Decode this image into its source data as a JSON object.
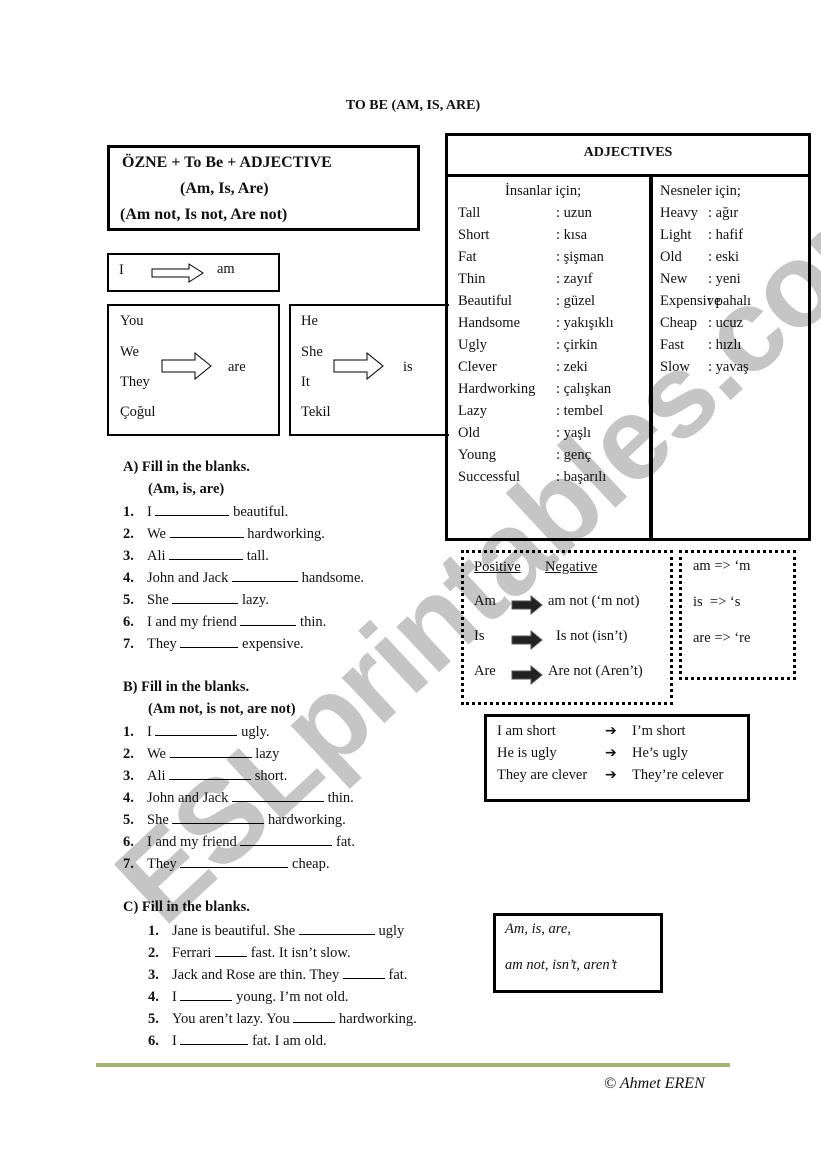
{
  "title": "TO BE (AM, IS, ARE)",
  "formula": {
    "line1": "ÖZNE   +  To Be  +  ADJECTIVE",
    "line2": "(Am, Is, Are)",
    "line3": "(Am not, Is not, Are not)"
  },
  "pronouns": {
    "first": {
      "subjects": [
        "I"
      ],
      "verb": "am"
    },
    "plural": {
      "subjects": [
        "You",
        "We",
        "They",
        "Çoğul"
      ],
      "verb": "are"
    },
    "singular": {
      "subjects": [
        "He",
        "She",
        "It",
        "Tekil"
      ],
      "verb": "is"
    }
  },
  "adjectives": {
    "heading": "ADJECTIVES",
    "people": {
      "heading": "İnsanlar için;",
      "items": [
        {
          "en": "Tall",
          "tr": ": uzun"
        },
        {
          "en": "Short",
          "tr": ": kısa"
        },
        {
          "en": "Fat",
          "tr": ": şişman"
        },
        {
          "en": "Thin",
          "tr": ": zayıf"
        },
        {
          "en": "Beautiful",
          "tr": ": güzel"
        },
        {
          "en": "Handsome",
          "tr": ": yakışıklı"
        },
        {
          "en": "Ugly",
          "tr": ": çirkin"
        },
        {
          "en": "Clever",
          "tr": ": zeki"
        },
        {
          "en": "Hardworking",
          "tr": ": çalışkan"
        },
        {
          "en": "Lazy",
          "tr": ": tembel"
        },
        {
          "en": "Old",
          "tr": ": yaşlı"
        },
        {
          "en": "Young",
          "tr": ": genç"
        },
        {
          "en": "Successful",
          "tr": ": başarılı"
        }
      ]
    },
    "objects": {
      "heading": "Nesneler için;",
      "items": [
        {
          "en": "Heavy",
          "tr": ": ağır"
        },
        {
          "en": "Light",
          "tr": ": hafif"
        },
        {
          "en": "Old",
          "tr": ": eski"
        },
        {
          "en": "New",
          "tr": ": yeni"
        },
        {
          "en": "Expensive",
          "tr": ": pahalı"
        },
        {
          "en": "Cheap",
          "tr": ": ucuz"
        },
        {
          "en": "Fast",
          "tr": ": hızlı"
        },
        {
          "en": "Slow",
          "tr": ": yavaş"
        }
      ]
    }
  },
  "negatives": {
    "positive_label": "Positive",
    "negative_label": "Negative",
    "rows": [
      {
        "pos": "Am",
        "neg": "am not (‘m not)"
      },
      {
        "pos": "Is",
        "neg": "Is not (isn’t)"
      },
      {
        "pos": "Are",
        "neg": "Are not (Aren’t)"
      }
    ]
  },
  "contractions": [
    "am => ‘m",
    "is  => ‘s",
    "are => ‘re"
  ],
  "examples": [
    {
      "full": "I am short",
      "short": "I’m short"
    },
    {
      "full": "He is ugly",
      "short": "He’s ugly"
    },
    {
      "full": "They are clever",
      "short": "They’re celever"
    }
  ],
  "exercise_a": {
    "heading": "A)  Fill in the blanks.",
    "subheading": "(Am, is, are)",
    "items": [
      {
        "n": "1.",
        "before": "I",
        "after": "beautiful."
      },
      {
        "n": "2.",
        "before": "We",
        "after": "hardworking."
      },
      {
        "n": "3.",
        "before": "Ali",
        "after": "tall."
      },
      {
        "n": "4.",
        "before": "John and Jack",
        "after": "handsome."
      },
      {
        "n": "5.",
        "before": "She",
        "after": "lazy."
      },
      {
        "n": "6.",
        "before": "I and my friend",
        "after": "thin."
      },
      {
        "n": "7.",
        "before": "They",
        "after": "expensive."
      }
    ]
  },
  "exercise_b": {
    "heading": "B)  Fill in the blanks.",
    "subheading": "(Am not, is not, are not)",
    "items": [
      {
        "n": "1.",
        "before": "I",
        "after": "ugly."
      },
      {
        "n": "2.",
        "before": "We",
        "after": "lazy"
      },
      {
        "n": "3.",
        "before": "Ali",
        "after": "short."
      },
      {
        "n": "4.",
        "before": "John and Jack",
        "after": "thin."
      },
      {
        "n": "5.",
        "before": "She",
        "after": "hardworking."
      },
      {
        "n": "6.",
        "before": "I and my friend",
        "after": "fat."
      },
      {
        "n": "7.",
        "before": "They",
        "after": "cheap."
      }
    ]
  },
  "exercise_c": {
    "heading": "C)  Fill in the blanks.",
    "items": [
      {
        "n": "1.",
        "before": "Jane is beautiful. She",
        "after": "ugly"
      },
      {
        "n": "2.",
        "before": "Ferrari",
        "after": "fast. It isn’t slow."
      },
      {
        "n": "3.",
        "before": "Jack and Rose are thin. They",
        "after": "fat."
      },
      {
        "n": "4.",
        "before": "I",
        "after": "young. I’m not old."
      },
      {
        "n": "5.",
        "before": "You aren’t lazy.  You",
        "after": "hardworking."
      },
      {
        "n": "6.",
        "before": "I",
        "after": "fat. I am old."
      }
    ]
  },
  "word_bank": {
    "line1": "Am, is, are,",
    "line2": "am not, isn’t, aren’t"
  },
  "copyright": "© Ahmet EREN",
  "watermark": "ESLprintables.com",
  "colors": {
    "footer_line": "#a4b476"
  }
}
